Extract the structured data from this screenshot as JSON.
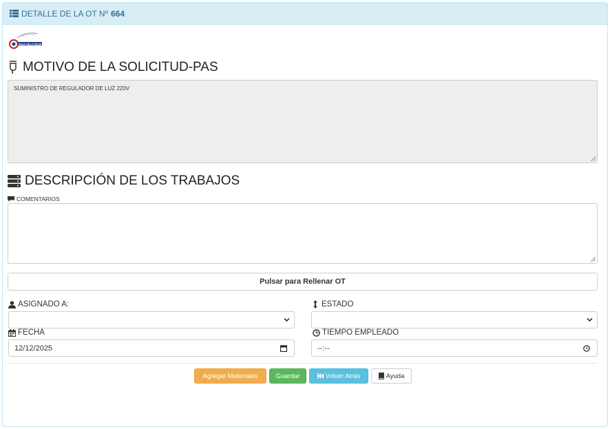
{
  "header": {
    "title": "DETALLE DE LA OT Nº",
    "ot_number": "664"
  },
  "logo": {
    "text": "RIGA HELP DESK"
  },
  "motivo": {
    "title": "MOTIVO DE LA SOLICITUD-PAS",
    "text": "SUMINISTRO DE REGULADOR DE LUZ 220V"
  },
  "descripcion": {
    "title": "DESCRIPCIÓN DE LOS TRABAJOS",
    "comments_label": "COMENTARIOS",
    "comments_value": ""
  },
  "fill_button": {
    "label": "Pulsar para Rellenar OT"
  },
  "form": {
    "asignado_label": "ASIGNADO A:",
    "asignado_value": "",
    "estado_label": "ESTADO",
    "estado_value": "",
    "fecha_label": "FECHA",
    "fecha_value": "12/12/2025",
    "tiempo_label": "TIEMPO EMPLEADO",
    "tiempo_value": "--:--"
  },
  "actions": {
    "add_materials": "Agregar Materiales",
    "save": "Guardar",
    "back": "Volver Atrás",
    "help": "Ayuda"
  },
  "colors": {
    "heading_bg": "#d9edf7",
    "heading_text": "#31708f",
    "warning": "#f0ad4e",
    "success": "#5cb85c",
    "info": "#5bc0de"
  }
}
